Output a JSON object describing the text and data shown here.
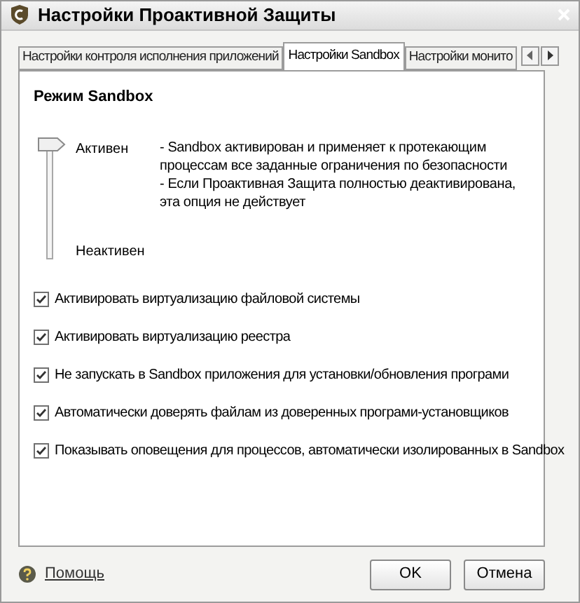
{
  "window": {
    "title": "Настройки Проактивной Защиты"
  },
  "tabs": [
    {
      "label": "Настройки контроля исполнения приложений",
      "selected": false
    },
    {
      "label": "Настройки Sandbox",
      "selected": true
    },
    {
      "label": "Настройки монито",
      "selected": false
    }
  ],
  "section": {
    "title": "Режим Sandbox"
  },
  "slider": {
    "level": 1,
    "top_label": "Активен",
    "bottom_label": "Неактивен",
    "description": [
      "- Sandbox активирован и применяет к протекающим процессам все заданные ограничения по безопасности",
      "- Если Проактивная Защита полностью деактивирована, эта опция не действует"
    ]
  },
  "options": [
    {
      "label": "Активировать виртуализацию файловой системы",
      "checked": true
    },
    {
      "label": "Активировать виртуализацию реестра",
      "checked": true
    },
    {
      "label": "Не запускать в Sandbox приложения для установки/обновления програми",
      "checked": true
    },
    {
      "label": "Автоматически доверять файлам из доверенных програми-установщиков",
      "checked": true
    },
    {
      "label": "Показывать оповещения для процессов, автоматически изолированных в Sandbox",
      "checked": true
    }
  ],
  "footer": {
    "help": "Помощь",
    "buttons": [
      "OK",
      "Отмена"
    ]
  }
}
